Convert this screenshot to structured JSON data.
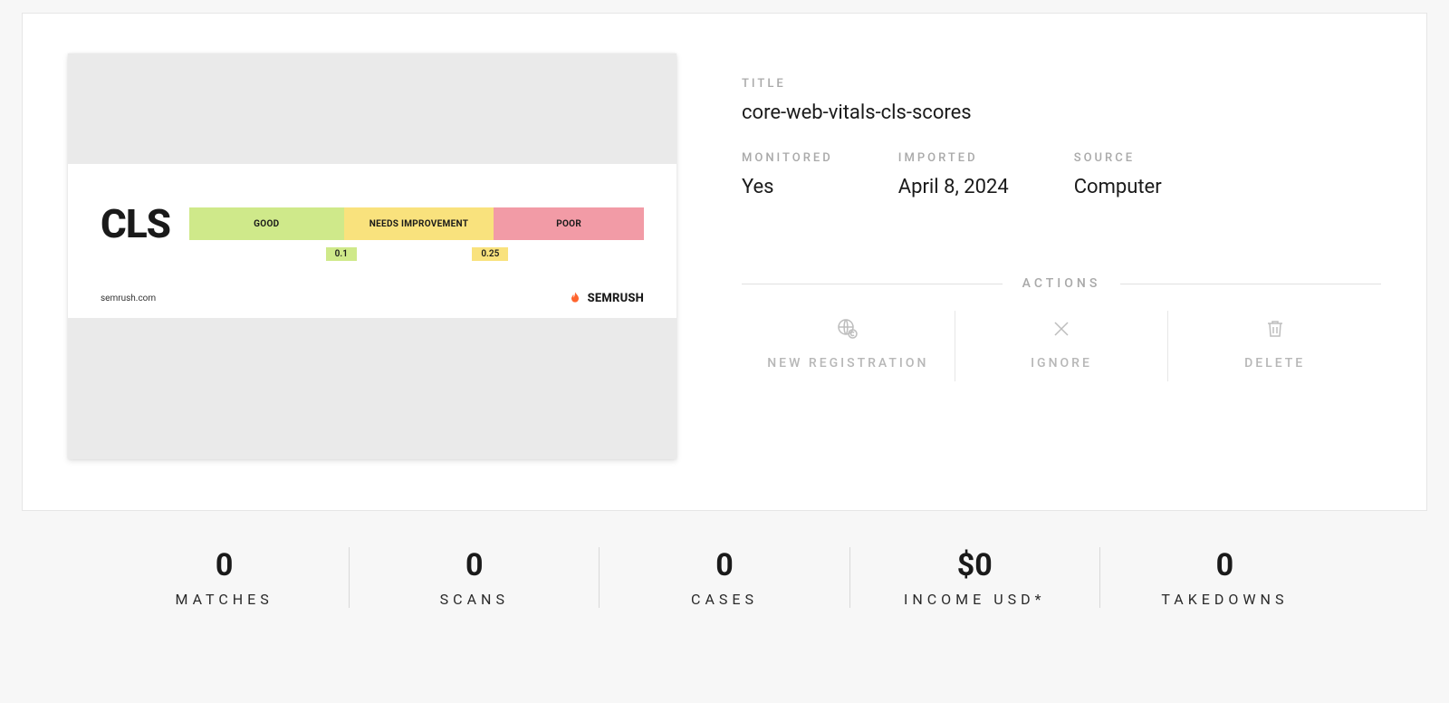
{
  "thumbnail": {
    "heading": "CLS",
    "segments": {
      "good": "GOOD",
      "mid": "NEEDS IMPROVEMENT",
      "poor": "POOR"
    },
    "thresholds": {
      "first": "0.1",
      "second": "0.25"
    },
    "domain": "semrush.com",
    "brand": "SEMRUSH"
  },
  "details": {
    "title_label": "TITLE",
    "title_value": "core-web-vitals-cls-scores",
    "monitored_label": "MONITORED",
    "monitored_value": "Yes",
    "imported_label": "IMPORTED",
    "imported_value": "April 8, 2024",
    "source_label": "SOURCE",
    "source_value": "Computer"
  },
  "actions": {
    "heading": "ACTIONS",
    "new_registration": "NEW REGISTRATION",
    "ignore": "IGNORE",
    "delete": "DELETE"
  },
  "stats": {
    "matches": {
      "value": "0",
      "label": "MATCHES"
    },
    "scans": {
      "value": "0",
      "label": "SCANS"
    },
    "cases": {
      "value": "0",
      "label": "CASES"
    },
    "income": {
      "value": "$0",
      "label": "INCOME USD*"
    },
    "takedowns": {
      "value": "0",
      "label": "TAKEDOWNS"
    }
  }
}
